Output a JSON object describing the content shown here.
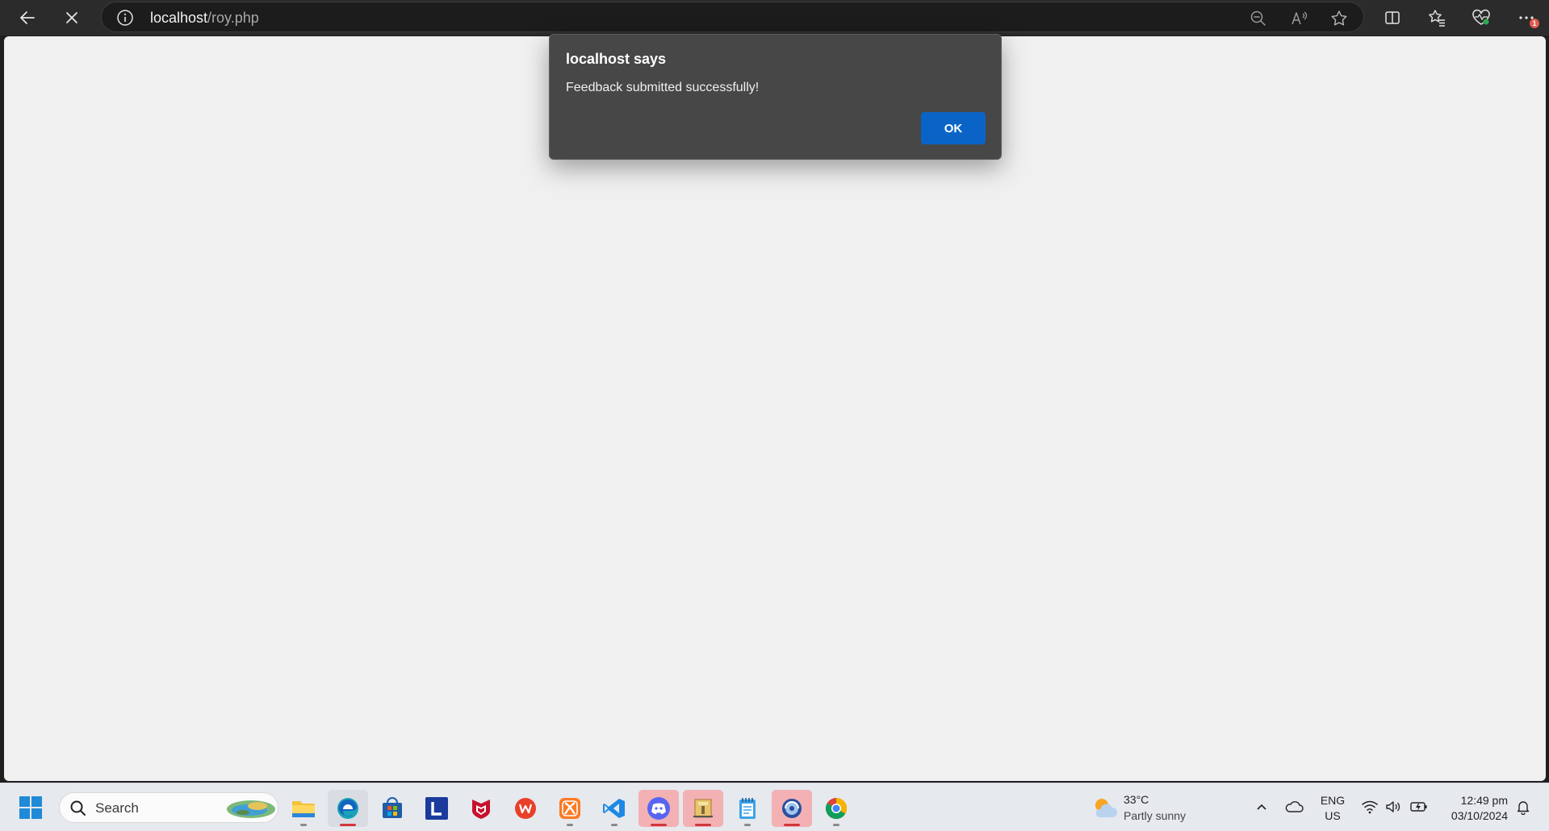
{
  "browser": {
    "address": {
      "host": "localhost",
      "path": "/roy.php"
    }
  },
  "dialog": {
    "title": "localhost says",
    "message": "Feedback submitted successfully!",
    "ok_label": "OK"
  },
  "toolbar": {
    "notification_badge": "1"
  },
  "taskbar": {
    "search_label": "Search",
    "apps": [
      "file-explorer",
      "edge",
      "microsoft-store",
      "l-app",
      "mcafee",
      "wps-office",
      "xampp",
      "vs-code",
      "discord",
      "archive-manager",
      "notepad",
      "network-app",
      "chrome"
    ],
    "weather": {
      "temp": "33°C",
      "desc": "Partly sunny"
    },
    "lang": {
      "line1": "ENG",
      "line2": "US"
    },
    "clock": {
      "time": "12:49 pm",
      "date": "03/10/2024"
    }
  },
  "colors": {
    "dialog_bg": "#474747",
    "ok_button": "#0a64c8",
    "page_bg": "#f0f0f0",
    "taskbar_bg": "#e6e9ee"
  }
}
